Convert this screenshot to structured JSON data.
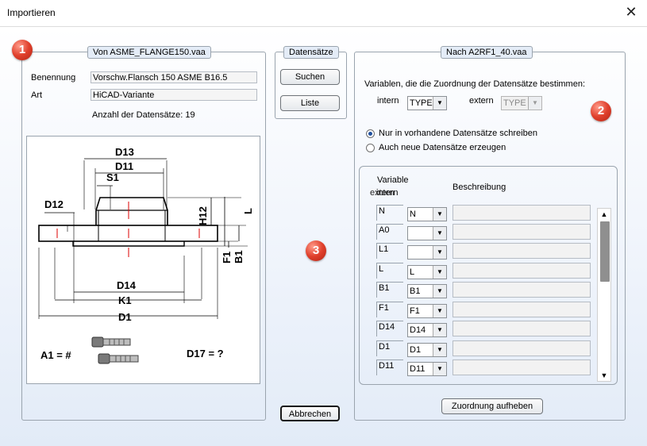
{
  "window": {
    "title": "Importieren"
  },
  "left": {
    "legend": "Von  ASME_FLANGE150.vaa",
    "badge": "1",
    "benennung_label": "Benennung",
    "benennung_value": "Vorschw.Flansch 150 ASME B16.5",
    "art_label": "Art",
    "art_value": "HiCAD-Variante",
    "count_text": "Anzahl der Datensätze: 19",
    "drawing": {
      "labels": [
        "D13",
        "D11",
        "S1",
        "D12",
        "H12",
        "L",
        "B1",
        "F1",
        "D14",
        "K1",
        "D1"
      ],
      "a1": "A1  =  #",
      "d17": "D17  =  ?"
    }
  },
  "middle": {
    "legend": "Datensätze",
    "search": "Suchen",
    "list": "Liste",
    "badge": "3",
    "cancel": "Abbrechen"
  },
  "right": {
    "legend": "Nach  A2RF1_40.vaa",
    "badge": "2",
    "vars_text": "Variablen, die die Zuordnung der Datensätze bestimmen:",
    "intern_label": "intern",
    "intern_value": "TYPE",
    "extern_label": "extern",
    "extern_value": "TYPE",
    "radio1": "Nur in vorhandene Datensätze schreiben",
    "radio2": "Auch neue Datensätze erzeugen",
    "col_variable": "Variable",
    "col_intern": "intern",
    "col_extern": "extern",
    "col_desc": "Beschreibung",
    "rows": [
      {
        "intern": "N",
        "extern": "N"
      },
      {
        "intern": "A0",
        "extern": ""
      },
      {
        "intern": "L1",
        "extern": ""
      },
      {
        "intern": "L",
        "extern": "L"
      },
      {
        "intern": "B1",
        "extern": "B1"
      },
      {
        "intern": "F1",
        "extern": "F1"
      },
      {
        "intern": "D14",
        "extern": "D14"
      },
      {
        "intern": "D1",
        "extern": "D1"
      },
      {
        "intern": "D11",
        "extern": "D11"
      }
    ],
    "unassign": "Zuordnung aufheben"
  },
  "icons": {
    "close": "close-icon",
    "arrow": "chevron-down-icon",
    "bolt": "bolt-icon"
  },
  "colors": {
    "badge": "#e0402c",
    "accent": "#1f4f9d"
  }
}
